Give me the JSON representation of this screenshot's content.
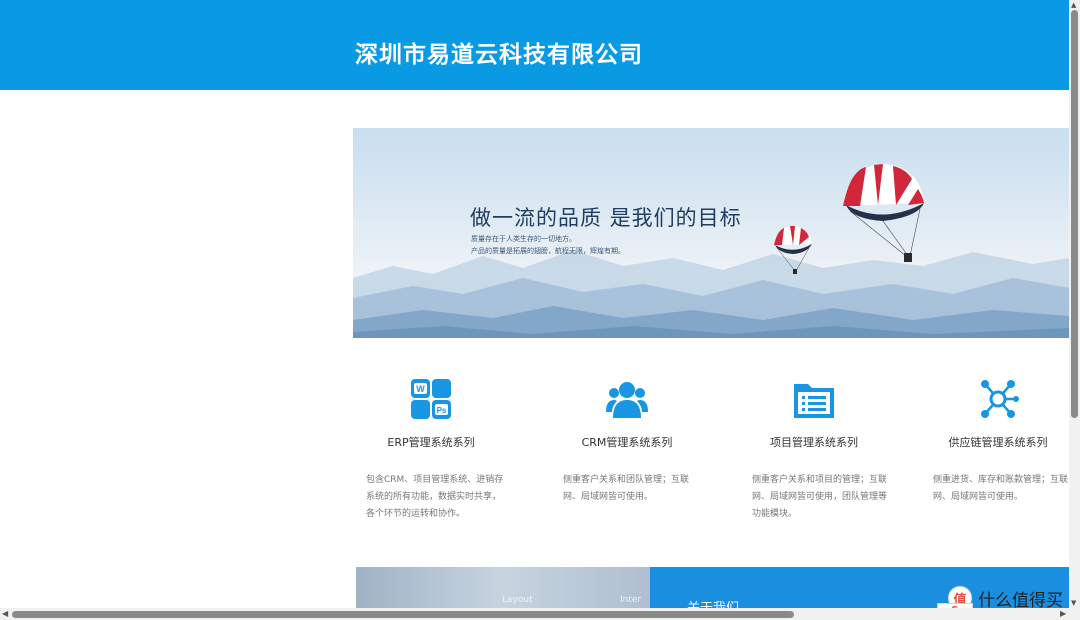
{
  "header": {
    "company_name": "深圳市易道云科技有限公司"
  },
  "banner": {
    "headline": "做一流的品质 是我们的目标",
    "subline1": "质量存在于人类生存的一切地方。",
    "subline2": "产品的质量是拓展的翅膀，航程无限，辉煌有期。"
  },
  "features": [
    {
      "icon": "office-apps-icon",
      "title": "ERP管理系统系列",
      "description": "包含CRM、项目管理系统、进销存系统的所有功能，数据实时共享，各个环节的运转和协作。"
    },
    {
      "icon": "user-group-icon",
      "title": "CRM管理系统系列",
      "description": "侧重客户关系和团队管理；互联网、局域网皆可使用。"
    },
    {
      "icon": "folder-list-icon",
      "title": "项目管理系统系列",
      "description": "侧重客户关系和项目的管理；互联网、局域网皆可使用，团队管理等功能模块。"
    },
    {
      "icon": "network-nodes-icon",
      "title": "供应链管理系统系列",
      "description": "侧重进货、库存和账款管理；互联网、局域网皆可使用。"
    }
  ],
  "bottom": {
    "layout_text": "Layout",
    "inter_text": "Inter",
    "about_label": "关于我们"
  },
  "watermark": {
    "text": "什么值得买",
    "icon_glyph": "值",
    "ime_label": "S"
  },
  "colors": {
    "brand_blue": "#0a9ae3",
    "icon_blue": "#1896e3"
  }
}
